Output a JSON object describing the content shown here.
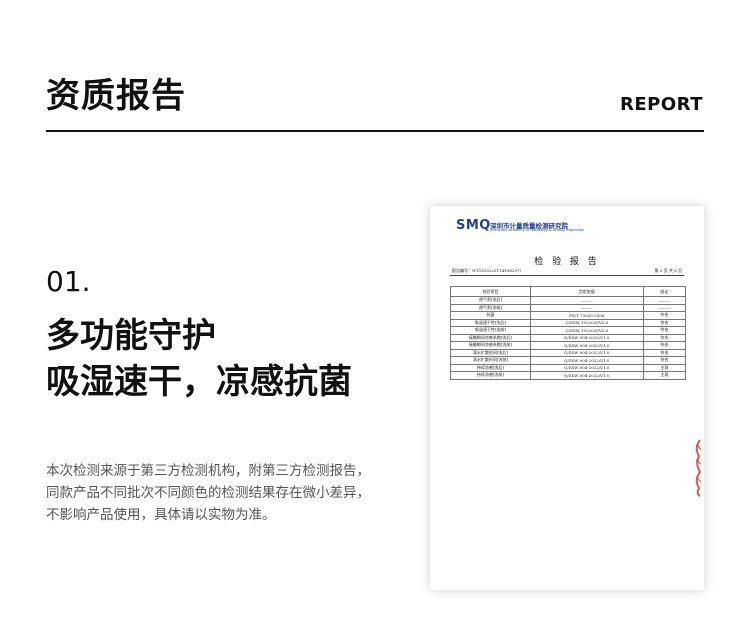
{
  "header": {
    "title": "资质报告",
    "title_en": "REPORT"
  },
  "section": {
    "number": "01.",
    "headline_1": "多功能守护",
    "headline_2": "吸湿速干，凉感抗菌"
  },
  "description": [
    "本次检测来源于第三方检测机构，附第三方检测报告，",
    "同款产品不同批次不同颜色的检测结果存在微小差异，",
    "不影响产品使用，具体请以实物为准。"
  ],
  "document": {
    "logo": "SMQ",
    "org_name": "深圳市计量质量检测研究院",
    "org_name_en": "Shenzhen Academy of Metrology & Quality Inspection",
    "title": "检 验 报 告",
    "report_no": "报告编号：WT1610223114106297）",
    "page_info": "第 3 页 共 6 页",
    "table": {
      "headers": [
        "检验项目",
        "判定依据",
        "结论"
      ],
      "rows": [
        [
          "透气率[洗后]",
          "———",
          "———"
        ],
        [
          "透气率[洗前]",
          "———",
          "———"
        ],
        [
          "抗菌",
          "FZ/T 73023-2006",
          "符合"
        ],
        [
          "吸湿速干性[洗后]",
          "Q/ZSW 19-2020/V2.0",
          "符合"
        ],
        [
          "吸湿速干性[洗前]",
          "Q/ZSW 19-2020/V2.0",
          "符合"
        ],
        [
          "接触瞬间凉感系数[洗后]",
          "Q/ZSW 004-2022/V1.0",
          "符合"
        ],
        [
          "接触瞬间凉感系数[洗前]",
          "Q/ZSW 004-2022/V1.0",
          "符合"
        ],
        [
          "滴水扩散时间[洗后]",
          "Q/ZSW 004-2022/V1.0",
          "符合"
        ],
        [
          "滴水扩散时间[洗前]",
          "Q/ZSW 004-2022/V1.0",
          "符合"
        ],
        [
          "持续凉感[洗后]",
          "Q/ZSW 004-2022/V1.0",
          "主观"
        ],
        [
          "持续凉感[洗前]",
          "Q/ZSW 004-2022/V1.0",
          "主观"
        ]
      ]
    },
    "colors": {
      "logo": "#23418f",
      "stamp": "#d23a3a"
    }
  }
}
